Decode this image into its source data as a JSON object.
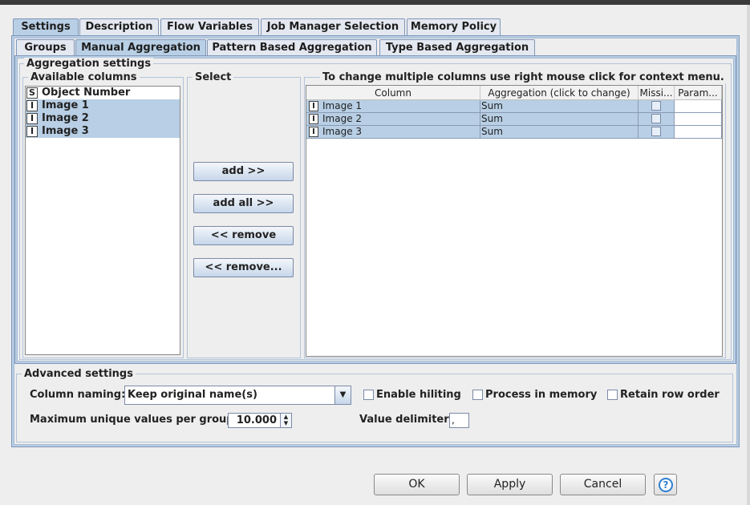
{
  "top_tabs": [
    "Settings",
    "Description",
    "Flow Variables",
    "Job Manager Selection",
    "Memory Policy"
  ],
  "sub_tabs": [
    "Groups",
    "Manual Aggregation",
    "Pattern Based Aggregation",
    "Type Based Aggregation"
  ],
  "aggregation": {
    "title": "Aggregation settings",
    "available_title": "Available columns",
    "select_title": "Select",
    "table_title": "To change multiple columns use right mouse click for context menu.",
    "columns": [
      {
        "type": "S",
        "name": "Object Number",
        "selected": false
      },
      {
        "type": "I",
        "name": "Image 1",
        "selected": true
      },
      {
        "type": "I",
        "name": "Image 2",
        "selected": true
      },
      {
        "type": "I",
        "name": "Image 3",
        "selected": true
      }
    ],
    "buttons": {
      "add": "add >>",
      "add_all": "add all >>",
      "remove": "<< remove",
      "remove_all": "<< remove..."
    },
    "table_headers": [
      "Column",
      "Aggregation (click to change)",
      "Missi...",
      "Param..."
    ],
    "rows": [
      {
        "type": "I",
        "column": "Image 1",
        "aggregation": "Sum"
      },
      {
        "type": "I",
        "column": "Image 2",
        "aggregation": "Sum"
      },
      {
        "type": "I",
        "column": "Image 3",
        "aggregation": "Sum"
      }
    ]
  },
  "advanced": {
    "title": "Advanced settings",
    "column_naming_label": "Column naming:",
    "column_naming_value": "Keep original name(s)",
    "enable_hiliting": "Enable hiliting",
    "process_in_memory": "Process in memory",
    "retain_row_order": "Retain row order",
    "max_unique_label": "Maximum unique values per group",
    "max_unique_value": "10.000",
    "value_delimiter_label": "Value delimiter",
    "value_delimiter_value": ","
  },
  "dialog_buttons": {
    "ok": "OK",
    "apply": "Apply",
    "cancel": "Cancel"
  },
  "icons": {
    "help": "help-icon",
    "dropdown": "chevron-down-icon"
  },
  "colors": {
    "selection": "#b8cfe5",
    "accent": "#2f7fd0"
  }
}
